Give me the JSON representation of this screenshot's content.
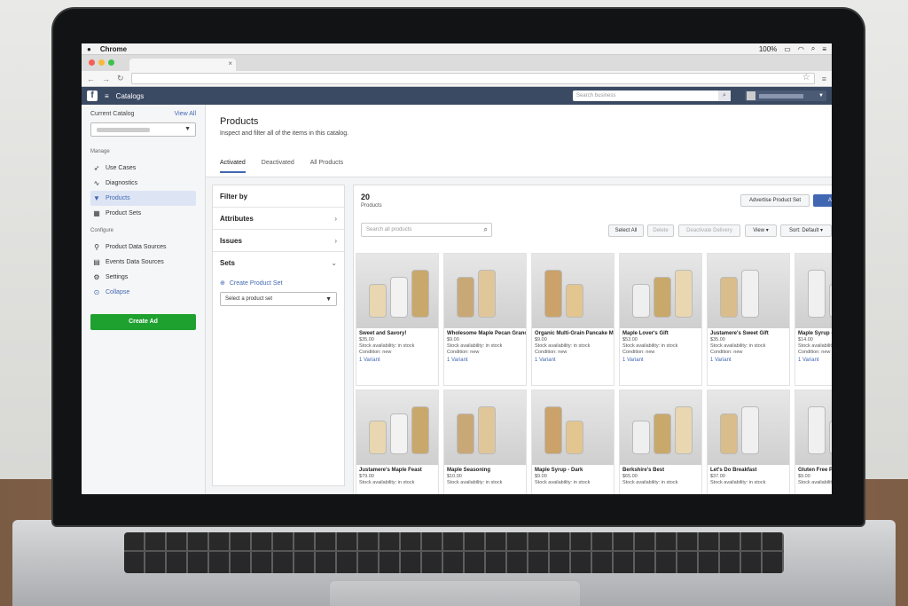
{
  "menubar": {
    "apple": "",
    "app": "Chrome",
    "battery": "100%"
  },
  "fbbar": {
    "logo": "f",
    "title": "Catalogs",
    "search_placeholder": "Search business"
  },
  "sidebar": {
    "current_catalog_label": "Current Catalog",
    "view_all": "View All",
    "manage_label": "Manage",
    "configure_label": "Configure",
    "manage_items": [
      {
        "label": "Use Cases",
        "icon": "rocket-icon"
      },
      {
        "label": "Diagnostics",
        "icon": "pulse-icon"
      },
      {
        "label": "Products",
        "icon": "shirt-icon"
      },
      {
        "label": "Product Sets",
        "icon": "grid-icon"
      }
    ],
    "configure_items": [
      {
        "label": "Product Data Sources",
        "icon": "link-icon"
      },
      {
        "label": "Events Data Sources",
        "icon": "calendar-icon"
      },
      {
        "label": "Settings",
        "icon": "gear-icon"
      },
      {
        "label": "Collapse",
        "icon": "collapse-icon"
      }
    ],
    "create_ad": "Create Ad"
  },
  "page": {
    "title": "Products",
    "subtitle": "Inspect and filter all of the items in this catalog.",
    "tabs": [
      "Activated",
      "Deactivated",
      "All Products"
    ]
  },
  "filter": {
    "title": "Filter by",
    "sections": [
      "Attributes",
      "Issues",
      "Sets"
    ],
    "create_set": "Create Product Set",
    "select_set": "Select a product set"
  },
  "products": {
    "count": "20",
    "count_label": "Products",
    "advertise": "Advertise Product Set",
    "add": "Add P",
    "search_placeholder": "Search all products",
    "select_all": "Select All",
    "delete": "Delete",
    "deactivate": "Deactivate Delivery",
    "view": "View ▾",
    "sort": "Sort: Default ▾",
    "items": [
      {
        "title": "Sweet and Savory!",
        "price": "$35.00",
        "stock": "Stock availability: in stock",
        "cond": "Condition: new",
        "variant": "1 Variant"
      },
      {
        "title": "Wholesome Maple Pecan Granola",
        "price": "$9.00",
        "stock": "Stock availability: in stock",
        "cond": "Condition: new",
        "variant": "1 Variant"
      },
      {
        "title": "Organic Multi-Grain Pancake Mix",
        "price": "$9.00",
        "stock": "Stock availability: in stock",
        "cond": "Condition: new",
        "variant": "1 Variant"
      },
      {
        "title": "Maple Lover's Gift",
        "price": "$53.00",
        "stock": "Stock availability: in stock",
        "cond": "Condition: new",
        "variant": "1 Variant"
      },
      {
        "title": "Justamere's Sweet Gift",
        "price": "$35.00",
        "stock": "Stock availability: in stock",
        "cond": "Condition: new",
        "variant": "1 Variant"
      },
      {
        "title": "Maple Syrup - V",
        "price": "$14.00",
        "stock": "Stock availability: in stock",
        "cond": "Condition: new",
        "variant": "1 Variant"
      },
      {
        "title": "Justamere's Maple Feast",
        "price": "$79.00",
        "stock": "Stock availability: in stock",
        "cond": "",
        "variant": ""
      },
      {
        "title": "Maple Seasoning",
        "price": "$10.00",
        "stock": "Stock availability: in stock",
        "cond": "",
        "variant": ""
      },
      {
        "title": "Maple Syrup - Dark",
        "price": "$9.00",
        "stock": "Stock availability: in stock",
        "cond": "",
        "variant": ""
      },
      {
        "title": "Berkshire's Best",
        "price": "$65.00",
        "stock": "Stock availability: in stock",
        "cond": "",
        "variant": ""
      },
      {
        "title": "Let's Do Breakfast",
        "price": "$37.00",
        "stock": "Stock availability: in stock",
        "cond": "",
        "variant": ""
      },
      {
        "title": "Gluten Free Pan",
        "price": "$9.00",
        "stock": "Stock availability: in stock",
        "cond": "",
        "variant": ""
      }
    ]
  }
}
